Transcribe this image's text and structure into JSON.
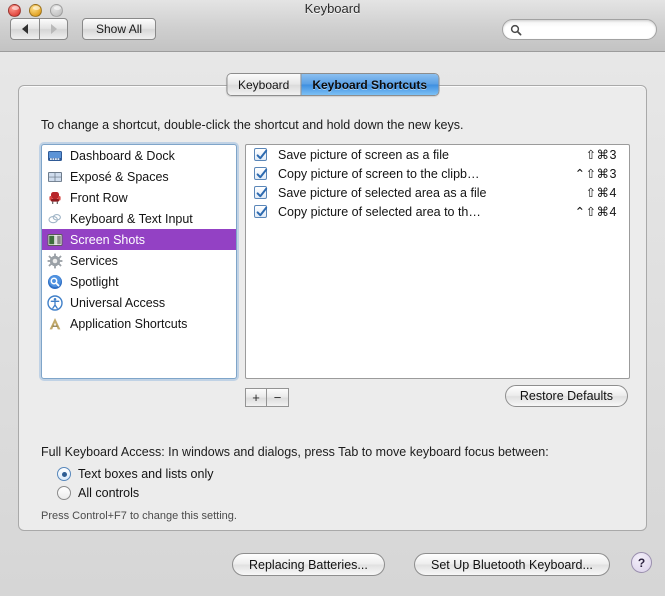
{
  "window": {
    "title": "Keyboard",
    "traffic_lights": [
      "close",
      "minimize",
      "zoom"
    ]
  },
  "toolbar": {
    "back_label": "back-arrow",
    "forward_label": "forward-arrow",
    "show_all_label": "Show All",
    "search": {
      "value": "",
      "placeholder": "",
      "icon": "search-icon"
    }
  },
  "tabs": [
    {
      "label": "Keyboard",
      "active": false
    },
    {
      "label": "Keyboard Shortcuts",
      "active": true
    }
  ],
  "main": {
    "hint": "To change a shortcut, double-click the shortcut and hold down the new keys.",
    "categories": [
      {
        "label": "Dashboard & Dock",
        "icon": "dock-icon",
        "selected": false
      },
      {
        "label": "Exposé & Spaces",
        "icon": "expose-grid-icon",
        "selected": false
      },
      {
        "label": "Front Row",
        "icon": "front-row-chair-icon",
        "selected": false
      },
      {
        "label": "Keyboard & Text Input",
        "icon": "keyboard-icon",
        "selected": false
      },
      {
        "label": "Screen Shots",
        "icon": "screenshot-icon",
        "selected": true
      },
      {
        "label": "Services",
        "icon": "gear-icon",
        "selected": false
      },
      {
        "label": "Spotlight",
        "icon": "spotlight-icon",
        "selected": false
      },
      {
        "label": "Universal Access",
        "icon": "accessibility-icon",
        "selected": false
      },
      {
        "label": "Application Shortcuts",
        "icon": "app-a-icon",
        "selected": false
      }
    ],
    "shortcuts": [
      {
        "checked": true,
        "name": "Save picture of screen as a file",
        "keys": "⇧⌘3"
      },
      {
        "checked": true,
        "name": "Copy picture of screen to the clipb…",
        "keys": "⌃⇧⌘3"
      },
      {
        "checked": true,
        "name": "Save picture of selected area as a file",
        "keys": "⇧⌘4"
      },
      {
        "checked": true,
        "name": "Copy picture of selected area to th…",
        "keys": "⌃⇧⌘4"
      }
    ],
    "add_label": "+",
    "remove_label": "−",
    "restore_defaults_label": "Restore Defaults"
  },
  "full_keyboard_access": {
    "title": "Full Keyboard Access: In windows and dialogs, press Tab to move keyboard focus between:",
    "options": [
      {
        "label": "Text boxes and lists only",
        "selected": true
      },
      {
        "label": "All controls",
        "selected": false
      }
    ],
    "note": "Press Control+F7 to change this setting."
  },
  "footer": {
    "replacing_batteries_label": "Replacing Batteries...",
    "bluetooth_label": "Set Up Bluetooth Keyboard...",
    "help_label": "?"
  },
  "colors": {
    "selection_purple": "#9341c4",
    "tab_active_blue": "#3f8fe0",
    "focus_ring_blue": "#7fa5c9"
  }
}
